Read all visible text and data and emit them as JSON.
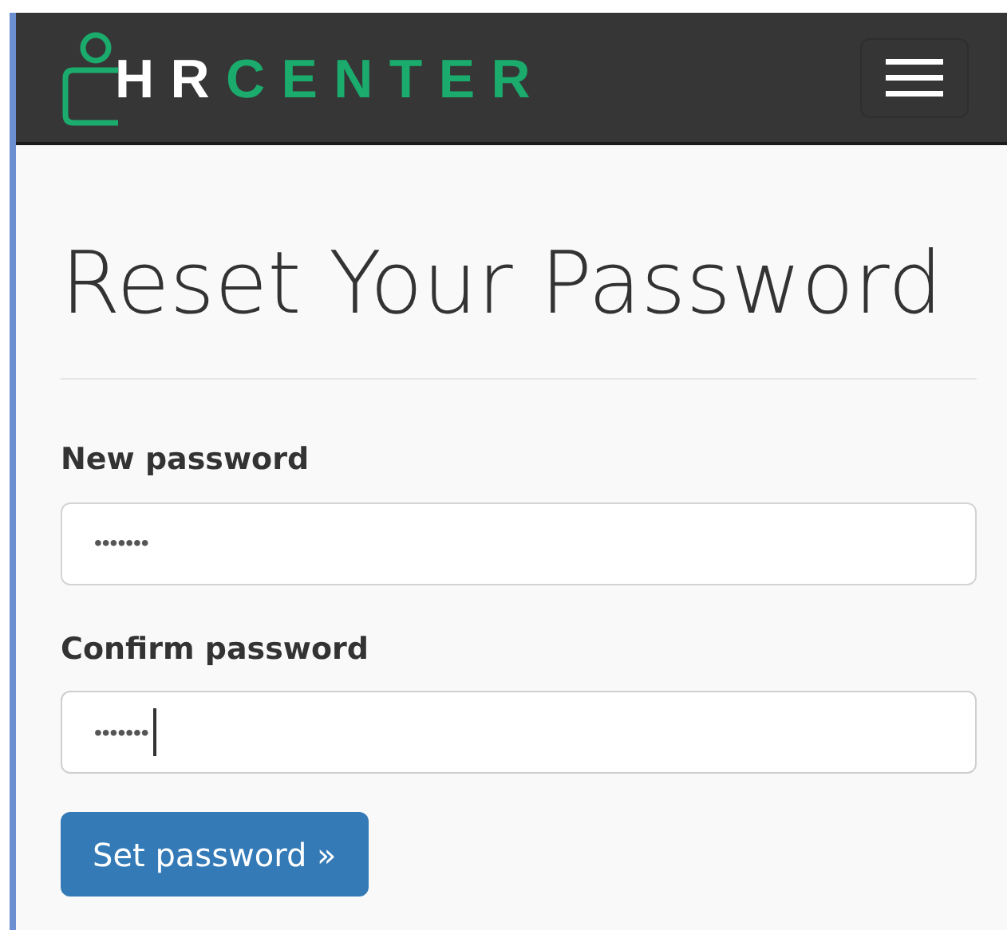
{
  "navbar": {
    "brand": [
      {
        "text": "HR",
        "kind": "light"
      },
      {
        "text": "CENTER",
        "kind": "accent"
      }
    ]
  },
  "heading": "Reset Your Password",
  "fields": [
    {
      "label": "New password",
      "value": "•••••••",
      "focused": false
    },
    {
      "label": "Confirm password",
      "value": "•••••••",
      "focused": true
    }
  ],
  "submit_button": "Set password »"
}
